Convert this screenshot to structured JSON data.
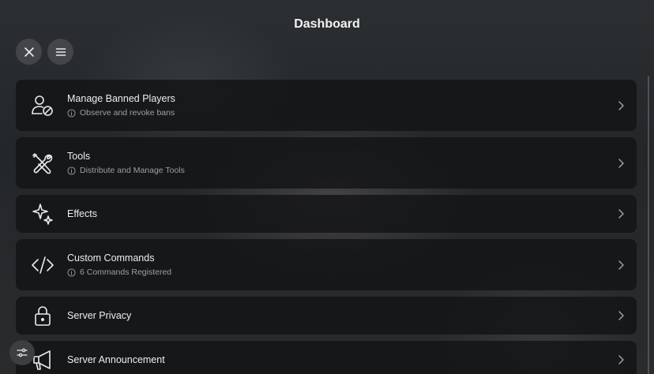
{
  "header": {
    "title": "Dashboard"
  },
  "items": [
    {
      "title": "Manage Banned Players",
      "subtitle": "Observe and revoke bans",
      "icon": "user-ban-icon"
    },
    {
      "title": "Tools",
      "subtitle": "Distribute and Manage Tools",
      "icon": "tools-icon"
    },
    {
      "title": "Effects",
      "icon": "sparkles-icon"
    },
    {
      "title": "Custom Commands",
      "subtitle": "6 Commands Registered",
      "icon": "code-icon"
    },
    {
      "title": "Server Privacy",
      "icon": "lock-icon"
    },
    {
      "title": "Server Announcement",
      "icon": "megaphone-icon"
    }
  ],
  "colors": {
    "card_bg": "#131416",
    "text_primary": "#eceef0",
    "text_secondary": "#9aa0a5"
  }
}
